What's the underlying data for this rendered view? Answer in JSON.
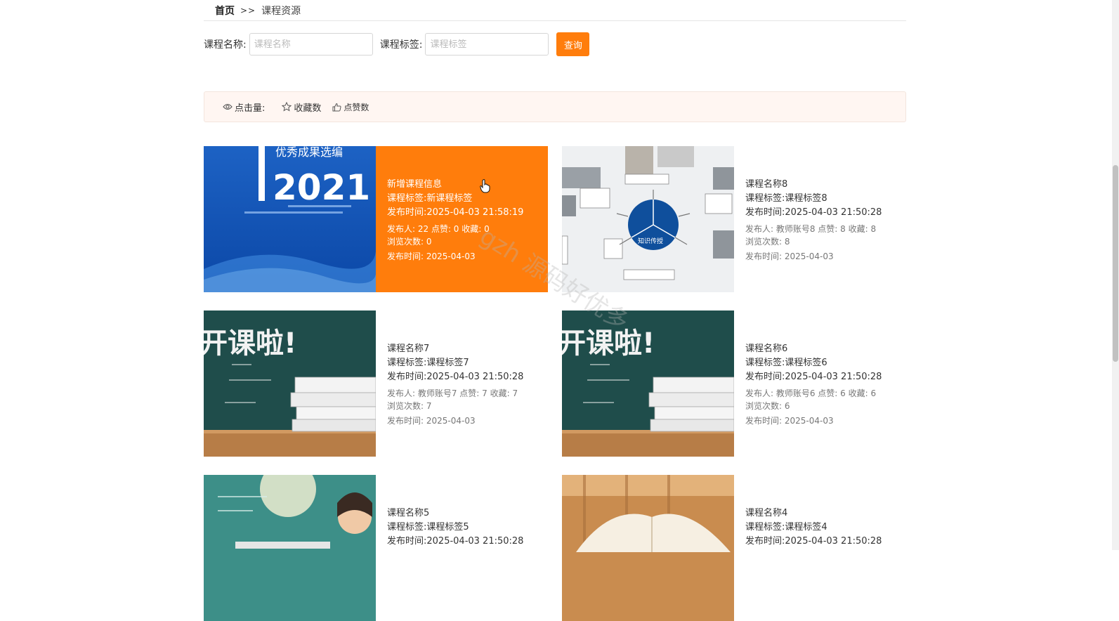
{
  "breadcrumb": {
    "home": "首页",
    "separator": ">>",
    "current": "课程资源"
  },
  "search": {
    "name_label": "课程名称:",
    "name_placeholder": "课程名称",
    "tag_label": "课程标签:",
    "tag_placeholder": "课程标签",
    "button": "查询"
  },
  "sort_bar": {
    "clicks": "点击量:",
    "favorites": "收藏数",
    "likes": "点赞数"
  },
  "cards": [
    {
      "title": "新增课程信息",
      "tag_line": "课程标签:新课程标签",
      "time_line": "发布时间:2025-04-03 21:58:19",
      "stats_line": "发布人:  22   点赞:  0   收藏:  0",
      "views_line": "浏览次数:  0",
      "date_line": "发布时间:  2025-04-03",
      "thumb": "report-2021",
      "thumb_text_a": "优秀成果选编",
      "thumb_text_b": "2021",
      "highlighted": true
    },
    {
      "title": "课程名称8",
      "tag_line": "课程标签:课程标签8",
      "time_line": "发布时间:2025-04-03 21:50:28",
      "stats_line": "发布人:  教师账号8   点赞:  8   收藏:  8",
      "views_line": "浏览次数:  8",
      "date_line": "发布时间:  2025-04-03",
      "thumb": "mindmap",
      "thumb_text_a": "知识传授",
      "highlighted": false
    },
    {
      "title": "课程名称7",
      "tag_line": "课程标签:课程标签7",
      "time_line": "发布时间:2025-04-03 21:50:28",
      "stats_line": "发布人:  教师账号7   点赞:  7   收藏:  7",
      "views_line": "浏览次数:  7",
      "date_line": "发布时间:  2025-04-03",
      "thumb": "chalkboard",
      "thumb_text_a": "开课啦!",
      "highlighted": false
    },
    {
      "title": "课程名称6",
      "tag_line": "课程标签:课程标签6",
      "time_line": "发布时间:2025-04-03 21:50:28",
      "stats_line": "发布人:  教师账号6   点赞:  6   收藏:  6",
      "views_line": "浏览次数:  6",
      "date_line": "发布时间:  2025-04-03",
      "thumb": "chalkboard",
      "thumb_text_a": "开课啦!",
      "highlighted": false
    },
    {
      "title": "课程名称5",
      "tag_line": "课程标签:课程标签5",
      "time_line": "发布时间:2025-04-03 21:50:28",
      "thumb": "classroom",
      "highlighted": false
    },
    {
      "title": "课程名称4",
      "tag_line": "课程标签:课程标签4",
      "time_line": "发布时间:2025-04-03 21:50:28",
      "thumb": "open-book",
      "highlighted": false
    }
  ],
  "watermark": "gzh 源码好优多",
  "colors": {
    "accent": "#ff7d0c",
    "sort_bar_bg": "#fff6f2"
  }
}
